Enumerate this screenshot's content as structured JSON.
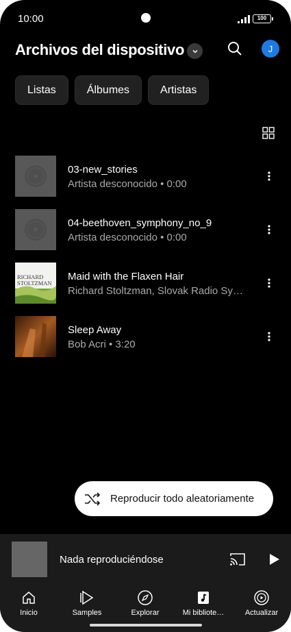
{
  "status_bar": {
    "time": "10:00",
    "battery": "100"
  },
  "header": {
    "title": "Archivos del dispositivo",
    "avatar_initial": "J"
  },
  "filter_chips": [
    {
      "label": "Listas"
    },
    {
      "label": "Álbumes"
    },
    {
      "label": "Artistas"
    }
  ],
  "tracks": [
    {
      "title": "03-new_stories",
      "subtitle": "Artista desconocido • 0:00",
      "thumb": "generic-disc"
    },
    {
      "title": "04-beethoven_symphony_no_9",
      "subtitle": "Artista desconocido • 0:00",
      "thumb": "generic-disc"
    },
    {
      "title": "Maid with the Flaxen Hair",
      "subtitle": "Richard Stoltzman, Slovak Radio Symphony Orchestra",
      "thumb": "album-art-stoltzman",
      "thumb_text_1": "RICHARD",
      "thumb_text_2": "STOLTZMAN"
    },
    {
      "title": "Sleep Away",
      "subtitle": "Bob Acri • 3:20",
      "thumb": "album-art-sleep-away"
    }
  ],
  "shuffle": {
    "label": "Reproducir todo aleatoriamente"
  },
  "mini_player": {
    "title": "Nada reproduciéndose"
  },
  "bottom_nav": [
    {
      "label": "Inicio",
      "icon": "home-icon"
    },
    {
      "label": "Samples",
      "icon": "samples-icon"
    },
    {
      "label": "Explorar",
      "icon": "explore-icon"
    },
    {
      "label": "Mi bibliote…",
      "icon": "library-icon"
    },
    {
      "label": "Actualizar",
      "icon": "upgrade-icon"
    }
  ],
  "colors": {
    "background": "#000000",
    "accent": "#1f7ae0",
    "secondary_text": "#aaaaaa",
    "surface": "#1b1b1b"
  }
}
